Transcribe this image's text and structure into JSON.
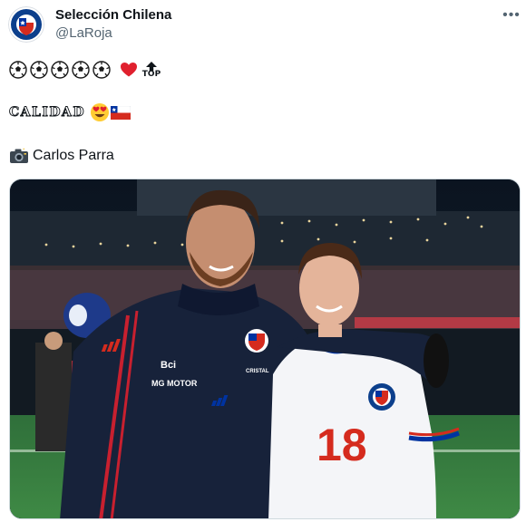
{
  "author": {
    "display_name": "Selección Chilena",
    "handle": "@LaRoja",
    "avatar_icon": "federation-crest-icon"
  },
  "menu": {
    "more_label": "•••"
  },
  "tweet": {
    "line1_icons": [
      "soccer-ball-icon",
      "soccer-ball-icon",
      "soccer-ball-icon",
      "soccer-ball-icon",
      "soccer-ball-icon",
      "red-heart-icon",
      "top-arrow-icon"
    ],
    "top_label": "TOP",
    "line2_text": "CALIDAD",
    "line2_icons": [
      "heart-eyes-icon",
      "chile-flag-icon"
    ],
    "camera_icon": "camera-icon",
    "photo_credit": "Carlos Parra"
  },
  "photo": {
    "jacket_brand": "Bci",
    "jacket_sponsor": "MG MOTOR",
    "jacket_chest_text": "CRISTAL",
    "shirt_number": "18",
    "colors": {
      "chile_red": "#d52b1e",
      "chile_blue": "#0033a0",
      "jacket": "#17223a",
      "shirt": "#f4f5f8"
    }
  }
}
